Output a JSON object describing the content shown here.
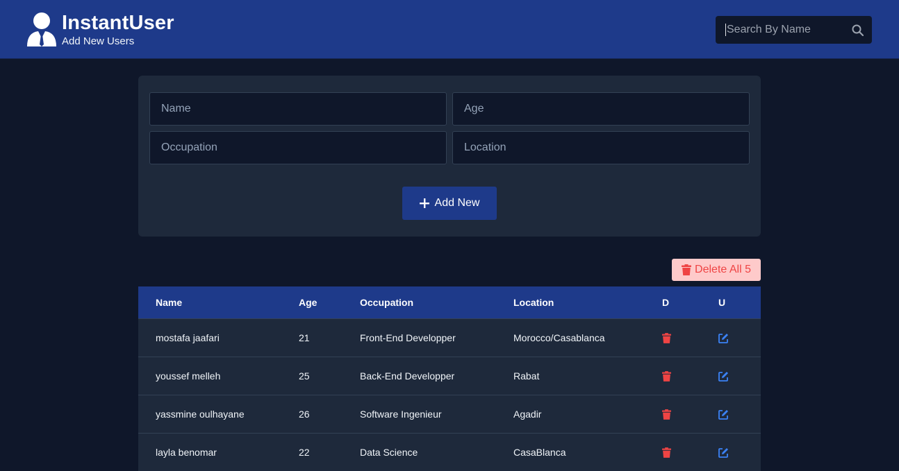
{
  "header": {
    "title": "InstantUser",
    "subtitle": "Add New Users",
    "search_placeholder": "Search By Name",
    "brand_icon": "user-tie-icon",
    "search_icon": "search-icon"
  },
  "form": {
    "name_placeholder": "Name",
    "age_placeholder": "Age",
    "occupation_placeholder": "Occupation",
    "location_placeholder": "Location",
    "add_label": "Add New",
    "add_icon": "plus-icon"
  },
  "delete_all": {
    "label": "Delete All 5",
    "icon": "trash-icon"
  },
  "table": {
    "headers": {
      "name": "Name",
      "age": "Age",
      "occupation": "Occupation",
      "location": "Location",
      "delete": "D",
      "update": "U"
    },
    "rows": [
      {
        "name": "mostafa jaafari",
        "age": "21",
        "occupation": "Front-End Developper",
        "location": "Morocco/Casablanca"
      },
      {
        "name": "youssef melleh",
        "age": "25",
        "occupation": "Back-End Developper",
        "location": "Rabat"
      },
      {
        "name": "yassmine oulhayane",
        "age": "26",
        "occupation": "Software Ingenieur",
        "location": "Agadir"
      },
      {
        "name": "layla benomar",
        "age": "22",
        "occupation": "Data Science",
        "location": "CasaBlanca"
      }
    ]
  },
  "colors": {
    "header_bg": "#1e3a8a",
    "page_bg": "#0f172a",
    "card_bg": "#1e293b",
    "delete_red": "#ef4444",
    "edit_blue": "#3b82f6",
    "delete_all_bg": "#fecaca"
  }
}
